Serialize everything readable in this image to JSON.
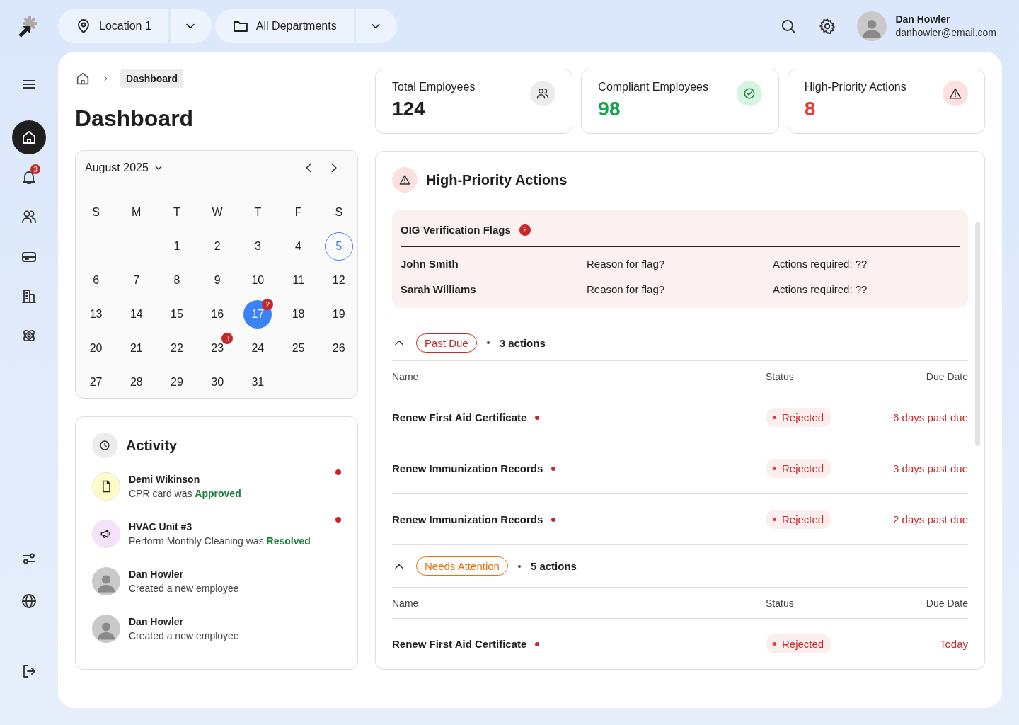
{
  "topbar": {
    "location": "Location 1",
    "department": "All Departments",
    "user": {
      "name": "Dan Howler",
      "email": "danhowler@email.com"
    }
  },
  "sidebar": {
    "items": [
      {
        "kind": "home",
        "selected": true
      },
      {
        "kind": "bell",
        "selected": false,
        "badge": "3"
      },
      {
        "kind": "users",
        "selected": false
      },
      {
        "kind": "inbox",
        "selected": false
      },
      {
        "kind": "building",
        "selected": false
      },
      {
        "kind": "atom",
        "selected": false
      }
    ],
    "bottom_items": [
      {
        "kind": "sliders",
        "selected": false
      },
      {
        "kind": "globe",
        "selected": false
      }
    ]
  },
  "breadcrumb": {
    "current": "Dashboard"
  },
  "title": "Dashboard",
  "stats": [
    {
      "label": "Total Employees",
      "value": "124",
      "kind": "neutral"
    },
    {
      "label": "Compliant Employees",
      "value": "98",
      "kind": "success"
    },
    {
      "label": "High-Priority Actions",
      "value": "8",
      "kind": "danger"
    }
  ],
  "calendar": {
    "month": "August 2025",
    "weekdays": [
      "S",
      "M",
      "T",
      "W",
      "T",
      "F",
      "S"
    ],
    "days": [
      {
        "kind": "blank"
      },
      {
        "kind": "blank"
      },
      {
        "kind": "day",
        "label": "1",
        "selected": false,
        "today": false
      },
      {
        "kind": "day",
        "label": "2",
        "selected": false,
        "today": false
      },
      {
        "kind": "day",
        "label": "3",
        "selected": false,
        "today": false
      },
      {
        "kind": "day",
        "label": "4",
        "selected": false,
        "today": false
      },
      {
        "kind": "day",
        "label": "5",
        "selected": false,
        "today": true
      },
      {
        "kind": "day",
        "label": "6",
        "selected": false,
        "today": false
      },
      {
        "kind": "day",
        "label": "7",
        "selected": false,
        "today": false
      },
      {
        "kind": "day",
        "label": "8",
        "selected": false,
        "today": false
      },
      {
        "kind": "day",
        "label": "9",
        "selected": false,
        "today": false
      },
      {
        "kind": "day",
        "label": "10",
        "selected": false,
        "today": false
      },
      {
        "kind": "day",
        "label": "11",
        "selected": false,
        "today": false
      },
      {
        "kind": "day",
        "label": "12",
        "selected": false,
        "today": false
      },
      {
        "kind": "day",
        "label": "13",
        "selected": false,
        "today": false
      },
      {
        "kind": "day",
        "label": "14",
        "selected": false,
        "today": false
      },
      {
        "kind": "day",
        "label": "15",
        "selected": false,
        "today": false
      },
      {
        "kind": "day",
        "label": "16",
        "selected": false,
        "today": false
      },
      {
        "kind": "day",
        "label": "17",
        "selected": true,
        "today": false,
        "badge": "2"
      },
      {
        "kind": "day",
        "label": "18",
        "selected": false,
        "today": false
      },
      {
        "kind": "day",
        "label": "19",
        "selected": false,
        "today": false
      },
      {
        "kind": "day",
        "label": "20",
        "selected": false,
        "today": false
      },
      {
        "kind": "day",
        "label": "21",
        "selected": false,
        "today": false
      },
      {
        "kind": "day",
        "label": "22",
        "selected": false,
        "today": false
      },
      {
        "kind": "day",
        "label": "23",
        "selected": false,
        "today": false,
        "badge": "3"
      },
      {
        "kind": "day",
        "label": "24",
        "selected": false,
        "today": false
      },
      {
        "kind": "day",
        "label": "25",
        "selected": false,
        "today": false
      },
      {
        "kind": "day",
        "label": "26",
        "selected": false,
        "today": false
      },
      {
        "kind": "day",
        "label": "27",
        "selected": false,
        "today": false
      },
      {
        "kind": "day",
        "label": "28",
        "selected": false,
        "today": false
      },
      {
        "kind": "day",
        "label": "29",
        "selected": false,
        "today": false
      },
      {
        "kind": "day",
        "label": "30",
        "selected": false,
        "today": false
      },
      {
        "kind": "day",
        "label": "31",
        "selected": false,
        "today": false
      }
    ]
  },
  "activity": {
    "title": "Activity",
    "items": [
      {
        "kind": "document",
        "name": "Demi Wikinson",
        "text": "CPR card was **Approved**",
        "unread": true
      },
      {
        "kind": "megaphone",
        "name": "HVAC Unit #3",
        "text": "Perform Monthly Cleaning was **Resolved**",
        "unread": true
      },
      {
        "kind": "avatar",
        "name": "Dan Howler",
        "text": "Created a new employee",
        "unread": false
      },
      {
        "kind": "avatar",
        "name": "Dan Howler",
        "text": "Created a new employee",
        "unread": false
      }
    ]
  },
  "priority": {
    "title": "High-Priority Actions",
    "flags": {
      "title": "OIG Verification Flags",
      "count": "2",
      "rows": [
        {
          "name": "John Smith",
          "reason": "Reason for flag?",
          "actions": "Actions required: ??"
        },
        {
          "name": "Sarah Williams",
          "reason": "Reason for flag?",
          "actions": "Actions required: ??"
        }
      ]
    },
    "groups": [
      {
        "label": "Past Due",
        "kind": "past_due",
        "count": "3 actions",
        "expanded": true,
        "columns": [
          "Name",
          "Status",
          "Due Date"
        ],
        "rows": [
          {
            "name": "Renew First Aid Certificate",
            "status": "Rejected",
            "due": "6 days past due"
          },
          {
            "name": "Renew Immunization Records",
            "status": "Rejected",
            "due": "3 days past due"
          },
          {
            "name": "Renew Immunization Records",
            "status": "Rejected",
            "due": "2 days past due"
          }
        ]
      },
      {
        "label": "Needs Attention",
        "kind": "needs_attention",
        "count": "5 actions",
        "expanded": true,
        "columns": [
          "Name",
          "Status",
          "Due Date"
        ],
        "rows": [
          {
            "name": "Renew First Aid Certificate",
            "status": "Rejected",
            "due": "Today"
          }
        ]
      }
    ]
  }
}
